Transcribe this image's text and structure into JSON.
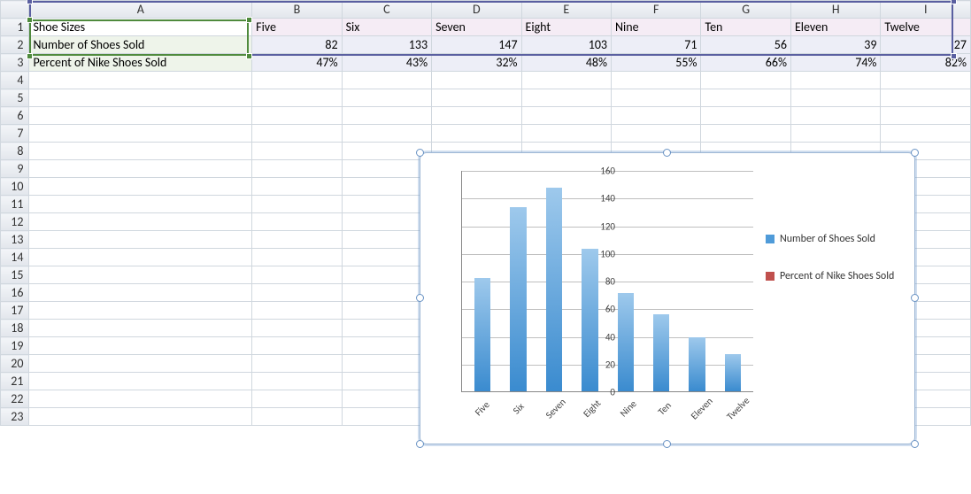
{
  "columns": [
    "A",
    "B",
    "C",
    "D",
    "E",
    "F",
    "G",
    "H",
    "I"
  ],
  "row_numbers": [
    1,
    2,
    3,
    4,
    5,
    6,
    7,
    8,
    9,
    10,
    11,
    12,
    13,
    14,
    15,
    16,
    17,
    18,
    19,
    20,
    21,
    22,
    23
  ],
  "table": {
    "row1_label": "Shoe Sizes",
    "row2_label": "Number of Shoes Sold",
    "row3_label": "Percent of Nike Shoes Sold",
    "categories": [
      "Five",
      "Six",
      "Seven",
      "Eight",
      "Nine",
      "Ten",
      "Eleven",
      "Twelve"
    ],
    "number_sold": [
      82,
      133,
      147,
      103,
      71,
      56,
      39,
      27
    ],
    "pct_nike": [
      "47%",
      "43%",
      "32%",
      "48%",
      "55%",
      "66%",
      "74%",
      "82%"
    ]
  },
  "chart_data": {
    "type": "bar",
    "categories": [
      "Five",
      "Six",
      "Seven",
      "Eight",
      "Nine",
      "Ten",
      "Eleven",
      "Twelve"
    ],
    "series": [
      {
        "name": "Number of Shoes Sold",
        "values": [
          82,
          133,
          147,
          103,
          71,
          56,
          39,
          27
        ],
        "color": "#4f9bd9"
      },
      {
        "name": "Percent of Nike Shoes Sold",
        "values": [
          0.47,
          0.43,
          0.32,
          0.48,
          0.55,
          0.66,
          0.74,
          0.82
        ],
        "color": "#c0504d"
      }
    ],
    "ylim": [
      0,
      160
    ],
    "yticks": [
      0,
      20,
      40,
      60,
      80,
      100,
      120,
      140,
      160
    ],
    "xlabel": "",
    "ylabel": "",
    "title": "",
    "legend_position": "right",
    "grid": true
  },
  "legend": {
    "s1": "Number of Shoes Sold",
    "s2": "Percent of Nike Shoes Sold"
  }
}
